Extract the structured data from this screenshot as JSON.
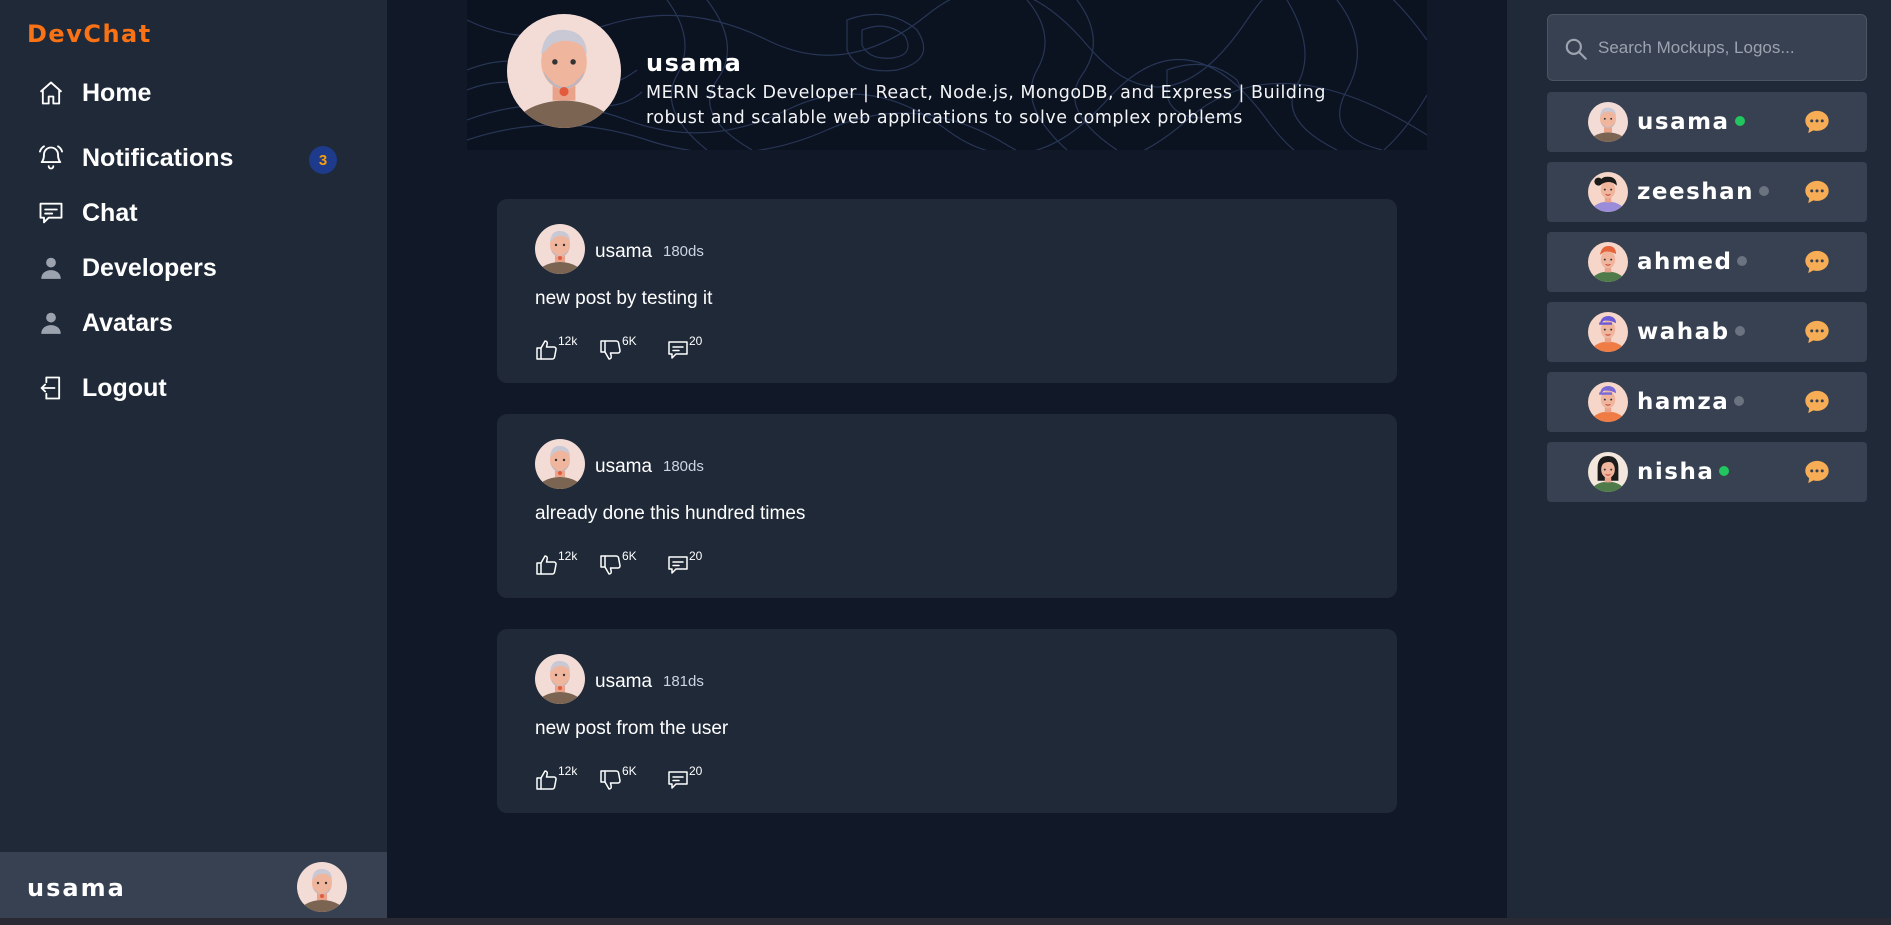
{
  "app": {
    "brand": "DevChat"
  },
  "sidebar": {
    "items": [
      {
        "label": "Home",
        "icon": "home-icon"
      },
      {
        "label": "Notifications",
        "icon": "bell-icon",
        "badge": "3"
      },
      {
        "label": "Chat",
        "icon": "chat-icon"
      },
      {
        "label": "Developers",
        "icon": "user-icon"
      },
      {
        "label": "Avatars",
        "icon": "user-icon"
      },
      {
        "label": "Logout",
        "icon": "logout-icon"
      }
    ],
    "profile": {
      "name": "usama"
    }
  },
  "banner": {
    "name": "usama",
    "bio": "MERN Stack Developer | React, Node.js, MongoDB, and Express | Building robust and scalable web applications to solve complex problems"
  },
  "posts": [
    {
      "user": "usama",
      "time": "180ds",
      "text": "new post by testing it",
      "likes": "12k",
      "dislikes": "6K",
      "comments": "20"
    },
    {
      "user": "usama",
      "time": "180ds",
      "text": "already done this hundred times",
      "likes": "12k",
      "dislikes": "6K",
      "comments": "20"
    },
    {
      "user": "usama",
      "time": "181ds",
      "text": "new post from the user",
      "likes": "12k",
      "dislikes": "6K",
      "comments": "20"
    }
  ],
  "search": {
    "placeholder": "Search Mockups, Logos..."
  },
  "contacts": [
    {
      "name": "usama",
      "online": true
    },
    {
      "name": "zeeshan",
      "online": false
    },
    {
      "name": "ahmed",
      "online": false
    },
    {
      "name": "wahab",
      "online": false
    },
    {
      "name": "hamza",
      "online": false
    },
    {
      "name": "nisha",
      "online": true
    }
  ],
  "colors": {
    "accent": "#f97316",
    "sidebar_bg": "#1f2937",
    "main_bg": "#111827",
    "card_bg": "#1f2937",
    "online": "#22c55e",
    "offline": "#6b7280",
    "chat_icon": "#f6ad55",
    "badge_bg": "#1e3a8a",
    "badge_text": "#f59e0b"
  }
}
